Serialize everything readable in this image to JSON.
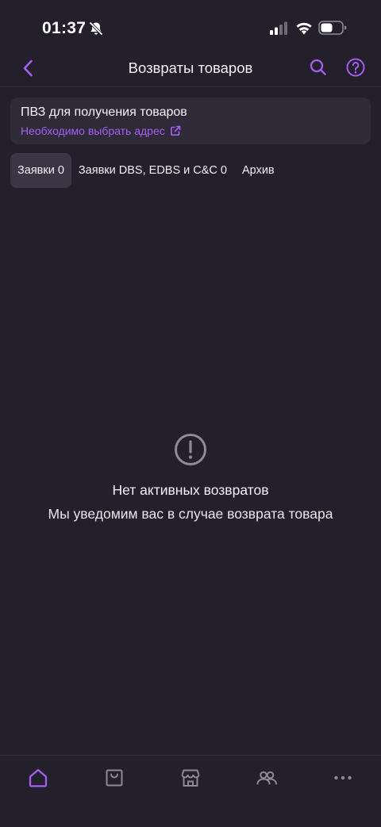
{
  "status_bar": {
    "time": "01:37"
  },
  "header": {
    "title": "Возвраты товаров",
    "back_icon": "chevron-left-icon",
    "search_icon": "search-icon",
    "help_icon": "help-circle-icon"
  },
  "pickup": {
    "title": "ПВЗ для получения товаров",
    "link_label": "Необходимо выбрать адрес"
  },
  "tabs": [
    {
      "label": "Заявки 0",
      "active": true
    },
    {
      "label": "Заявки DBS, EDBS и C&C 0",
      "active": false
    },
    {
      "label": "Архив",
      "active": false
    }
  ],
  "empty_state": {
    "icon": "alert-circle-icon",
    "title": "Нет активных возвратов",
    "subtitle": "Мы уведомим вас в случае возврата товара"
  },
  "bottom_nav": {
    "items": [
      "home-icon",
      "shopping-bag-icon",
      "store-icon",
      "friends-icon",
      "more-icon"
    ],
    "active": "home-icon"
  },
  "colors": {
    "background": "#231f2b",
    "card": "#2f2a38",
    "accent": "#a55ff2",
    "active_tab": "#3b3646",
    "muted_icon": "#8e8a96"
  }
}
